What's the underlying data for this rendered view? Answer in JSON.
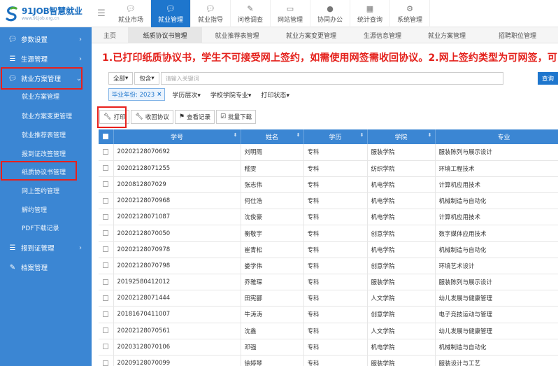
{
  "logo": {
    "main": "91JOB智慧就业",
    "sub": "www.91job.org.cn"
  },
  "topnav": [
    {
      "label": "就业市场",
      "icon": "chat-icon"
    },
    {
      "label": "就业管理",
      "icon": "chat-icon",
      "active": true
    },
    {
      "label": "就业指导",
      "icon": "chat-icon"
    },
    {
      "label": "问卷调查",
      "icon": "edit-icon"
    },
    {
      "label": "网站管理",
      "icon": "monitor-icon"
    },
    {
      "label": "协同办公",
      "icon": "apple-icon"
    },
    {
      "label": "统计查询",
      "icon": "chart-icon"
    },
    {
      "label": "系统管理",
      "icon": "gears-icon"
    }
  ],
  "sidebar": {
    "params": "参数设置",
    "student_source": "生源管理",
    "plan": "就业方案管理",
    "items": [
      "就业方案管理",
      "就业方案变更管理",
      "就业推荐表管理",
      "报到证改签管理",
      "纸质协议书管理",
      "网上签约管理",
      "解约管理",
      "PDF下载记录"
    ],
    "report_cert": "报到证管理",
    "archive": "档案管理"
  },
  "tabs": [
    "主页",
    "纸质协议书管理",
    "就业推荐表管理",
    "就业方案变更管理",
    "生源信息管理",
    "就业方案管理",
    "招聘职位管理"
  ],
  "notice": "1.已打印纸质协议书，学生不可接受网上签约，如需使用网签需收回协议。2.网上签约类型为可网签，可",
  "search": {
    "scope": "全部",
    "mode": "包含",
    "placeholder": "请输入关键词",
    "button": "查询"
  },
  "filters": {
    "year_chip": "毕业年份: 2023",
    "level": "学历层次",
    "major": "学校学院专业",
    "print_status": "打印状态"
  },
  "actions": {
    "print": "打印",
    "recall": "收回协议",
    "view_log": "查看记录",
    "batch_download": "批量下载"
  },
  "table": {
    "headers": [
      "学号",
      "姓名",
      "学历",
      "学院",
      "专业"
    ],
    "rows": [
      [
        "20202128070692",
        "刘明雨",
        "专科",
        "服装学院",
        "服装陈列与展示设计"
      ],
      [
        "20202128071255",
        "嵇雯",
        "专科",
        "纺织学院",
        "环境工程技术"
      ],
      [
        "2020812807029",
        "张志伟",
        "专科",
        "机电学院",
        "计算机应用技术"
      ],
      [
        "20202128070968",
        "何仕浩",
        "专科",
        "机电学院",
        "机械制造与自动化"
      ],
      [
        "20202128071087",
        "沈俊豪",
        "专科",
        "机电学院",
        "计算机应用技术"
      ],
      [
        "20202128070050",
        "衡敬宇",
        "专科",
        "创意学院",
        "数字媒体应用技术"
      ],
      [
        "20202128070978",
        "崔青松",
        "专科",
        "机电学院",
        "机械制造与自动化"
      ],
      [
        "20202128070798",
        "娄学伟",
        "专科",
        "创意学院",
        "环境艺术设计"
      ],
      [
        "20192580412012",
        "乔雅琛",
        "专科",
        "服装学院",
        "服装陈列与展示设计"
      ],
      [
        "20202128071444",
        "田宪郦",
        "专科",
        "人文学院",
        "幼儿发展与健康管理"
      ],
      [
        "20181670411007",
        "牛涛涛",
        "专科",
        "创意学院",
        "电子竞技运动与管理"
      ],
      [
        "20202128070561",
        "沈鑫",
        "专科",
        "人文学院",
        "幼儿发展与健康管理"
      ],
      [
        "20203128070106",
        "邓强",
        "专科",
        "机电学院",
        "机械制造与自动化"
      ],
      [
        "20209128070099",
        "徐婷琴",
        "专科",
        "服装学院",
        "服装设计与工艺"
      ]
    ]
  },
  "colors": {
    "primary": "#1e76cd",
    "sidebar": "#3b86d3",
    "notice": "#e4201b",
    "highlight_box": "#e8201c"
  }
}
